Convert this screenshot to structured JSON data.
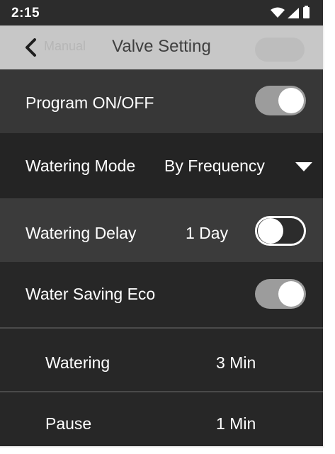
{
  "status_bar": {
    "time": "2:15",
    "icons": [
      "wifi-icon",
      "signal-icon",
      "battery-icon"
    ]
  },
  "header": {
    "title": "Valve Setting",
    "back_icon": "chevron-left-icon",
    "ghost_label": "Manual"
  },
  "settings": {
    "program": {
      "label": "Program ON/OFF",
      "toggle": "on"
    },
    "watering_mode": {
      "label": "Watering Mode",
      "value": "By Frequency",
      "icon": "triangle-down-icon"
    },
    "watering_delay": {
      "label": "Watering Delay",
      "value": "1 Day",
      "toggle": "off"
    },
    "water_saving_eco": {
      "label": "Water Saving Eco",
      "toggle": "on"
    },
    "watering": {
      "label": "Watering",
      "value": "3 Min"
    },
    "pause": {
      "label": "Pause",
      "value": "1 Min"
    }
  },
  "colors": {
    "header_bg": "#c7c7c7",
    "toggle_on": "#9c9c9c",
    "text": "#ffffff"
  }
}
